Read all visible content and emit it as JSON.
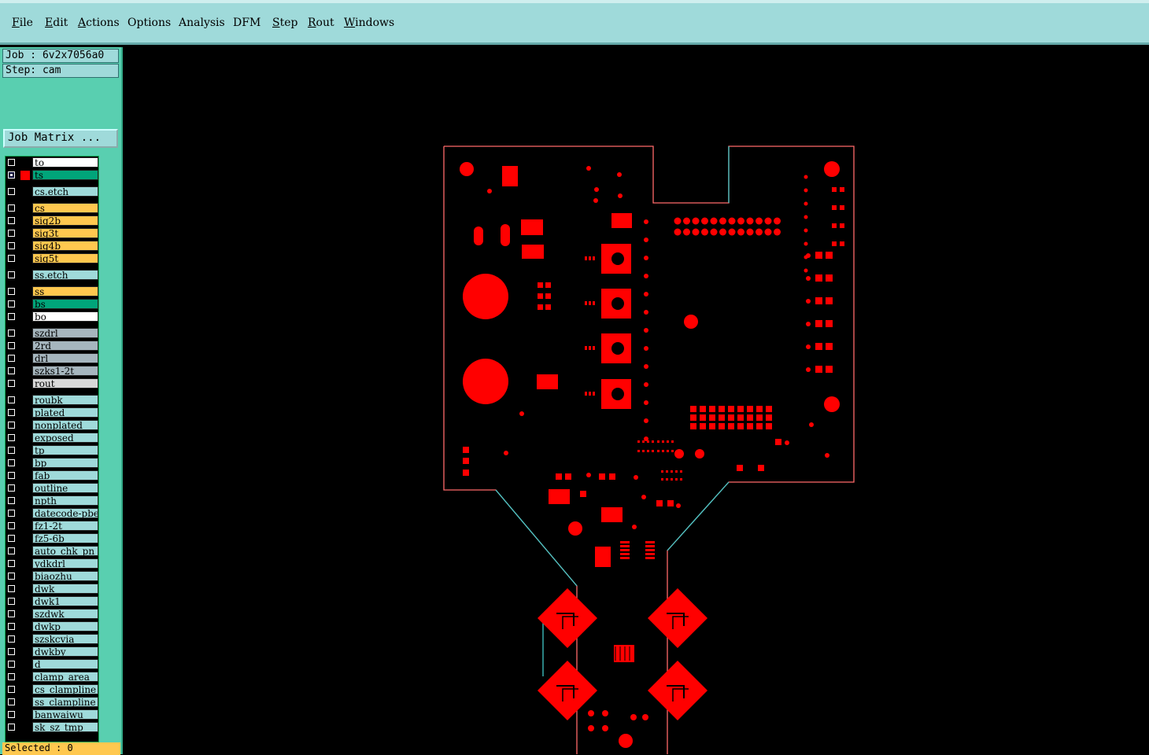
{
  "menu": [
    "File",
    "Edit",
    "Actions",
    "Options",
    "Analysis",
    "DFM",
    "Step",
    "Rout",
    "Windows"
  ],
  "job_label": "Job : 6v2x7056a0",
  "step_label": "Step: cam",
  "job_matrix_button": "Job Matrix ...",
  "layers": [
    {
      "name": "to",
      "color": "#ffffff",
      "active": false
    },
    {
      "name": "ts",
      "color": "#00a57a",
      "active": true
    },
    {
      "name": "cs.etch",
      "color": "#9fdada",
      "active": false
    },
    {
      "name": "cs",
      "color": "#ffc84f",
      "active": false
    },
    {
      "name": "sig2b",
      "color": "#ffc84f",
      "active": false
    },
    {
      "name": "sig3t",
      "color": "#ffc84f",
      "active": false
    },
    {
      "name": "sig4b",
      "color": "#ffc84f",
      "active": false
    },
    {
      "name": "sig5t",
      "color": "#ffc84f",
      "active": false
    },
    {
      "name": "ss.etch",
      "color": "#9fdada",
      "active": false
    },
    {
      "name": "ss",
      "color": "#ffc84f",
      "active": false
    },
    {
      "name": "bs",
      "color": "#00a57a",
      "active": false
    },
    {
      "name": "bo",
      "color": "#ffffff",
      "active": false
    },
    {
      "name": "szdrl",
      "color": "#a6b6be",
      "active": false
    },
    {
      "name": "2rd",
      "color": "#a6b6be",
      "active": false
    },
    {
      "name": "drl",
      "color": "#a6b6be",
      "active": false
    },
    {
      "name": "szks1-2t",
      "color": "#a6b6be",
      "active": false
    },
    {
      "name": "rout",
      "color": "#d9d9d9",
      "active": false
    },
    {
      "name": "roubk",
      "color": "#9fdada",
      "active": false
    },
    {
      "name": "plated",
      "color": "#9fdada",
      "active": false
    },
    {
      "name": "nonplated",
      "color": "#9fdada",
      "active": false
    },
    {
      "name": "exposed",
      "color": "#9fdada",
      "active": false
    },
    {
      "name": "tp",
      "color": "#9fdada",
      "active": false
    },
    {
      "name": "bp",
      "color": "#9fdada",
      "active": false
    },
    {
      "name": "fab",
      "color": "#9fdada",
      "active": false
    },
    {
      "name": "outline",
      "color": "#9fdada",
      "active": false
    },
    {
      "name": "npth",
      "color": "#9fdada",
      "active": false
    },
    {
      "name": "datecode-pbe",
      "color": "#9fdada",
      "active": false
    },
    {
      "name": "fz1-2t",
      "color": "#9fdada",
      "active": false
    },
    {
      "name": "fz5-6b",
      "color": "#9fdada",
      "active": false
    },
    {
      "name": "auto_chk_pn",
      "color": "#9fdada",
      "active": false
    },
    {
      "name": "ydkdrl",
      "color": "#9fdada",
      "active": false
    },
    {
      "name": "biaozhu",
      "color": "#9fdada",
      "active": false
    },
    {
      "name": "dwk",
      "color": "#9fdada",
      "active": false
    },
    {
      "name": "dwk1",
      "color": "#9fdada",
      "active": false
    },
    {
      "name": "szdwk",
      "color": "#9fdada",
      "active": false
    },
    {
      "name": "dwkp",
      "color": "#9fdada",
      "active": false
    },
    {
      "name": "szskcvia",
      "color": "#9fdada",
      "active": false
    },
    {
      "name": "dwkby",
      "color": "#9fdada",
      "active": false
    },
    {
      "name": "d",
      "color": "#9fdada",
      "active": false
    },
    {
      "name": "clamp_area",
      "color": "#9fdada",
      "active": false
    },
    {
      "name": "cs_clampline",
      "color": "#9fdada",
      "active": false
    },
    {
      "name": "ss_clampline",
      "color": "#9fdada",
      "active": false
    },
    {
      "name": "banwaiwu",
      "color": "#9fdada",
      "active": false
    },
    {
      "name": "sk_sz_tmp",
      "color": "#9fdada",
      "active": false
    }
  ],
  "selected_label": "Selected : 0",
  "colors": {
    "feature": "#ff0000",
    "outline": "#ff4d4d",
    "profile": "#40c8c8",
    "background": "#000000"
  }
}
